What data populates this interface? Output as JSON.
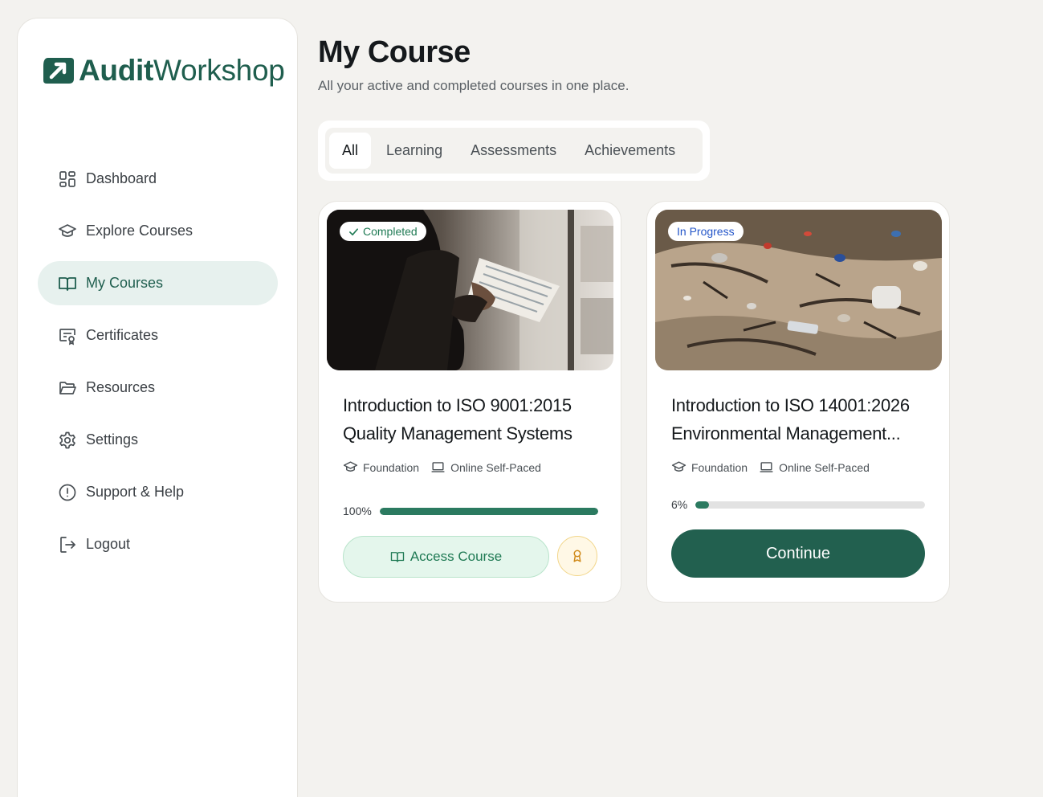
{
  "brand": {
    "name_bold": "Audit",
    "name_regular": "Workshop",
    "color": "#1f5e4e"
  },
  "nav": {
    "items": [
      {
        "label": "Dashboard",
        "icon": "dashboard-icon"
      },
      {
        "label": "Explore Courses",
        "icon": "graduation-cap-icon"
      },
      {
        "label": "My Courses",
        "icon": "open-book-icon",
        "active": true
      },
      {
        "label": "Certificates",
        "icon": "certificate-icon"
      },
      {
        "label": "Resources",
        "icon": "folder-icon"
      },
      {
        "label": "Settings",
        "icon": "gear-icon"
      },
      {
        "label": "Support & Help",
        "icon": "alert-circle-icon"
      },
      {
        "label": "Logout",
        "icon": "logout-icon"
      }
    ]
  },
  "header": {
    "title": "My Course",
    "subtitle": "All your active and completed courses in one place."
  },
  "tabs": [
    {
      "label": "All",
      "active": true
    },
    {
      "label": "Learning"
    },
    {
      "label": "Assessments"
    },
    {
      "label": "Achievements"
    }
  ],
  "courses": [
    {
      "status": "Completed",
      "title_line1": "Introduction to ISO 9001:2015",
      "title_line2": "Quality Management Systems",
      "level": "Foundation",
      "mode": "Online Self-Paced",
      "progress_label": "100%",
      "progress": 100,
      "action_label": "Access Course"
    },
    {
      "status": "In Progress",
      "title_line1": "Introduction to ISO 14001:2026",
      "title_line2": "Environmental Management...",
      "level": "Foundation",
      "mode": "Online Self-Paced",
      "progress_label": "6%",
      "progress": 6,
      "action_label": "Continue"
    }
  ],
  "colors": {
    "accent": "#22604f",
    "progress_fill": "#2b7a60",
    "completed_text": "#1f7a54",
    "in_progress_text": "#2456c9"
  }
}
